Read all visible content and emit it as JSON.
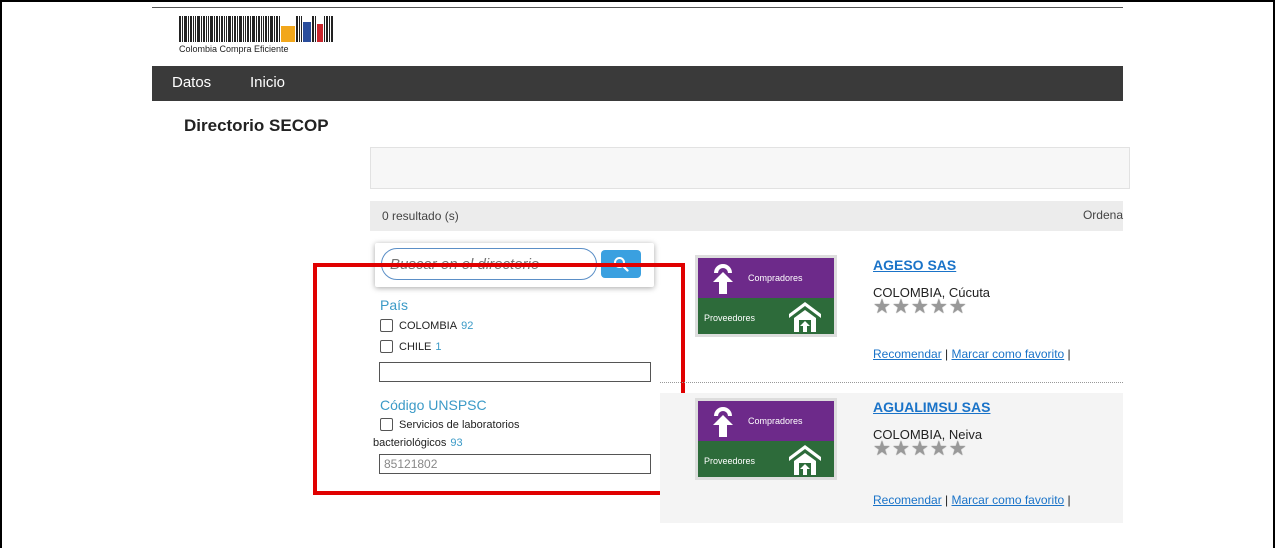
{
  "logo": {
    "text": "Colombia Compra Eficiente"
  },
  "nav": {
    "items": [
      "Datos",
      "Inicio"
    ]
  },
  "page": {
    "title": "Directorio SECOP"
  },
  "results_bar": {
    "count": "0 resultado (s)",
    "sort_label": "Ordena"
  },
  "search": {
    "placeholder": "Buscar en el directorio"
  },
  "filters": {
    "country": {
      "heading": "País",
      "options": [
        {
          "label": "COLOMBIA",
          "count": "92"
        },
        {
          "label": "CHILE",
          "count": "1"
        }
      ],
      "input_value": ""
    },
    "unspsc": {
      "heading": "Código UNSPSC",
      "option_line1": "Servicios de laboratorios",
      "option_line2": "bacteriológicos",
      "count": "93",
      "input_value": "85121802"
    }
  },
  "results": [
    {
      "name": "AGESO SAS",
      "location": "COLOMBIA, Cúcuta",
      "rating": 0
    },
    {
      "name": "AGUALIMSU SAS",
      "location": "COLOMBIA, Neiva",
      "rating": 0
    }
  ],
  "thumbnail": {
    "top_label": "Compradores",
    "bottom_label": "Proveedores"
  },
  "result_links": {
    "recommend": "Recomendar",
    "separator": " | ",
    "favorite": "Marcar como favorito",
    "trailing": " |"
  },
  "colors": {
    "highlight": "#e00000",
    "link": "#1a73c8",
    "accent": "#3b9ac7",
    "navbar": "#3a3a3a",
    "buyers": "#6d2a8a",
    "suppliers": "#2d6b3a"
  }
}
